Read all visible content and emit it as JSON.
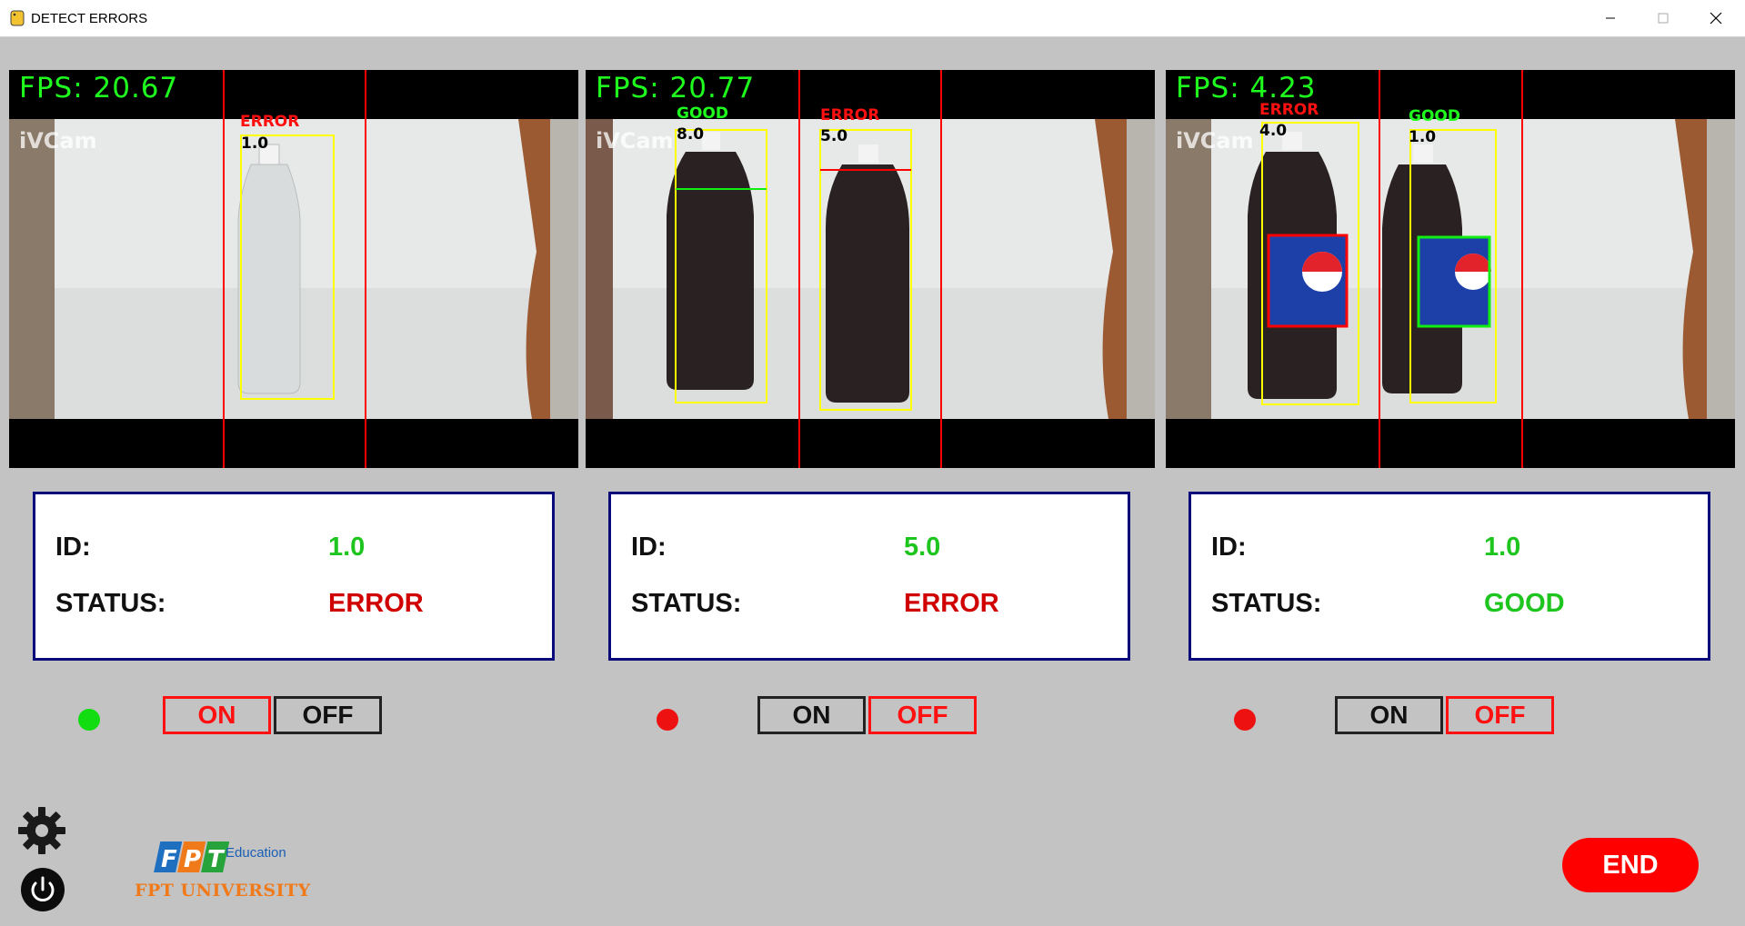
{
  "window": {
    "title": "DETECT ERRORS"
  },
  "cameras": [
    {
      "fps": "FPS: 20.67",
      "watermark": "iVCam",
      "detections": [
        {
          "tag": "ERROR",
          "id": "1.0"
        }
      ]
    },
    {
      "fps": "FPS: 20.77",
      "watermark": "iVCam",
      "detections": [
        {
          "tag": "GOOD",
          "id": "8.0"
        },
        {
          "tag": "ERROR",
          "id": "5.0"
        }
      ]
    },
    {
      "fps": "FPS: 4.23",
      "watermark": "iVCam",
      "detections": [
        {
          "tag": "ERROR",
          "id": "4.0"
        },
        {
          "tag": "GOOD",
          "id": "1.0"
        }
      ]
    }
  ],
  "panels": [
    {
      "id_label": "ID:",
      "id_value": "1.0",
      "status_label": "STATUS:",
      "status_value": "ERROR",
      "status_color": "#d00000"
    },
    {
      "id_label": "ID:",
      "id_value": "5.0",
      "status_label": "STATUS:",
      "status_value": "ERROR",
      "status_color": "#d00000"
    },
    {
      "id_label": "ID:",
      "id_value": "1.0",
      "status_label": "STATUS:",
      "status_value": "GOOD",
      "status_color": "#1ec51e"
    }
  ],
  "controls": [
    {
      "led_color": "#11dd11",
      "on_label": "ON",
      "off_label": "OFF",
      "active": "on"
    },
    {
      "led_color": "#ee1111",
      "on_label": "ON",
      "off_label": "OFF",
      "active": "off"
    },
    {
      "led_color": "#ee1111",
      "on_label": "ON",
      "off_label": "OFF",
      "active": "off"
    }
  ],
  "footer": {
    "logo_edu": "Education",
    "logo_name": "FPT UNIVERSITY",
    "end_label": "END",
    "settings_icon": "gear-icon",
    "power_icon": "power-icon"
  },
  "colors": {
    "accent_green": "#1ec51e",
    "accent_red": "#ff0000",
    "panel_border": "#0a0a7a",
    "background": "#c3c3c3"
  }
}
